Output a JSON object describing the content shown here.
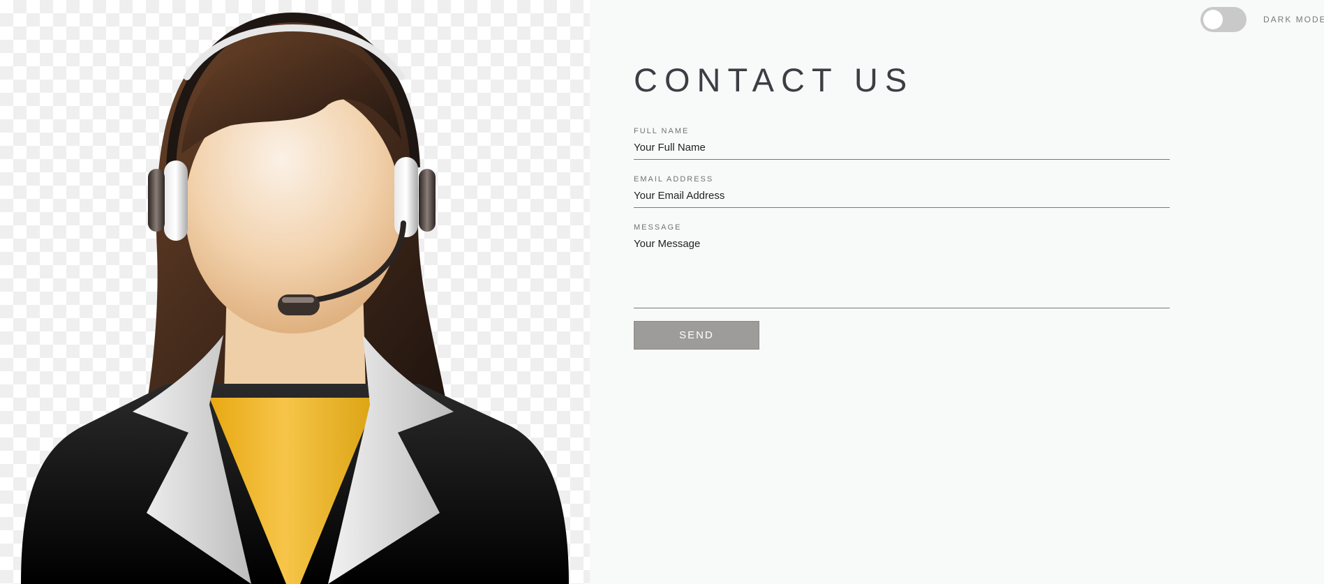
{
  "hero": {
    "image_alt": "customer-support-agent-illustration"
  },
  "dark_mode": {
    "label": "DARK MODE",
    "enabled": false
  },
  "contact": {
    "title": "CONTACT US",
    "full_name": {
      "label": "FULL NAME",
      "placeholder": "Your Full Name"
    },
    "email": {
      "label": "EMAIL ADDRESS",
      "placeholder": "Your Email Address"
    },
    "message": {
      "label": "MESSAGE",
      "placeholder": "Your Message"
    },
    "send_label": "SEND"
  },
  "colors": {
    "background": "#f8faf9",
    "title": "#3b3f44",
    "button": "#9e9c9b",
    "toggle_track": "#c9c9c9",
    "shirt": "#e6ae1e",
    "jacket": "#0a0a0a",
    "hair": "#3b2418"
  }
}
